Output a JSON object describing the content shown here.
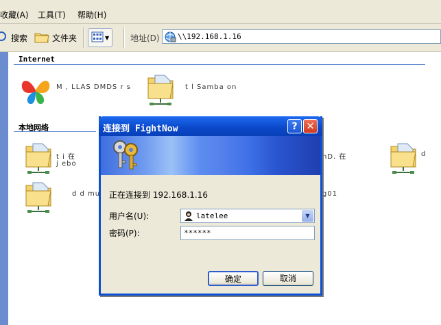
{
  "menubar": {
    "items": [
      "收藏(A)",
      "工具(T)",
      "帮助(H)"
    ]
  },
  "toolbar": {
    "search_label": "搜索",
    "folders_label": "文件夹",
    "views_icon": "views-icon",
    "address_label": "地址(D)",
    "address_value": "\\\\192.168.1.16"
  },
  "content": {
    "sections": [
      {
        "title": "Internet"
      },
      {
        "title": "本地网络"
      }
    ],
    "items": [
      {
        "icon": "msn-butterfly-icon",
        "text": "M  ,  LLAS  DMDS  r  s"
      },
      {
        "icon": "network-folder-icon",
        "text": "t  l  Samba on"
      },
      {
        "icon": "network-folder-icon",
        "text": "t  i  在"
      },
      {
        "icon": "network-folder-icon",
        "text": "j  ebo"
      },
      {
        "icon": "network-folder-icon",
        "text": "d  d  mul"
      },
      {
        "icon": "network-folder-icon",
        "text": "hD.  在"
      },
      {
        "icon": "network-folder-icon",
        "text": "g01"
      },
      {
        "icon": "network-folder-icon",
        "text": "d"
      }
    ]
  },
  "dialog": {
    "title": "连接到 FightNow",
    "help_button": "?",
    "close_button": "✕",
    "connecting_text": "正在连接到 192.168.1.16",
    "username_label": "用户名(U):",
    "username_value": "latelee",
    "password_label": "密码(P):",
    "password_value": "******",
    "ok_label": "确定",
    "cancel_label": "取消",
    "colors": {
      "titlebar": "#0a47c8",
      "close": "#e0452a"
    }
  }
}
